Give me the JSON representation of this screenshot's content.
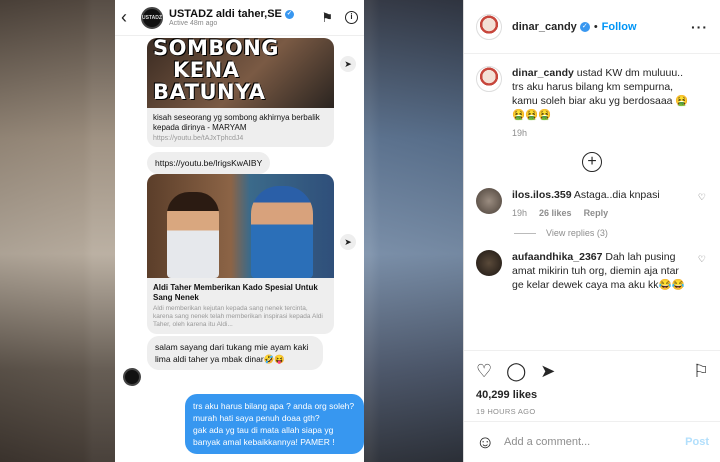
{
  "dm": {
    "back_icon": "‹",
    "avatar_text": "USTADZ",
    "name": "USTADZ aldi taher,SE",
    "status": "Active 48m ago",
    "verified_icon": "✓",
    "flag_icon": "⚑",
    "info_icon": "i",
    "card1": {
      "thumb_line1": "SOMBONG",
      "thumb_line2": "KENA",
      "thumb_line3": "BATUNYA",
      "title": "kisah seseorang yg sombong akhirnya berbalik kepada dirinya - MARYAM",
      "url": "https://youtu.be/tAJxTphcdJ4"
    },
    "link_message": "https://youtu.be/lrigsKwAIBY",
    "card2": {
      "title": "Aldi Taher Memberikan Kado Spesial Untuk Sang Nenek",
      "desc": "Aldi memberikan kejutan kepada sang nenek tercinta, karena sang nenek telah memberikan inspirasi kepada Aldi Taher, oleh karena itu Aldi..."
    },
    "play_icon": "➤",
    "grey_message": "salam sayang dari tukang mie ayam kaki lima aldi taher ya mbak dinar🤣😝",
    "blue_message_1": "trs aku harus bilang apa ? anda org soleh? murah hati saya penuh doaa gth?",
    "blue_message_2": "gak ada yg tau di mata allah siapa yg banyak amal kebaikkannya! PAMER !"
  },
  "post": {
    "username": "dinar_candy",
    "verified_icon": "✓",
    "follow_label": "Follow",
    "bullet": "•",
    "more_icon": "···",
    "caption_user": "dinar_candy",
    "caption_text": " ustad KW dm muluuu.. trs aku harus bilang km sempurna, kamu soleh biar aku yg berdosaaa 🤮🤮🤮🤮",
    "caption_time": "19h",
    "add_icon": "+",
    "comments": [
      {
        "user": "ilos.ilos.359",
        "text": " Astaga..dia knpasi",
        "time": "19h",
        "likes": "26 likes",
        "reply": "Reply",
        "view_replies": "View replies (3)"
      },
      {
        "user": "aufaandhika_2367",
        "text": " Dah lah pusing amat mikirin tuh org, diemin aja ntar ge kelar dewek caya ma aku kk😂😂"
      }
    ],
    "heart_small_icon": "♡",
    "like_icon": "♡",
    "comment_icon": "◯",
    "share_icon": "➤",
    "bookmark_icon": "⚐",
    "likes": "40,299 likes",
    "timestamp": "19 HOURS AGO",
    "emoji_icon": "☺",
    "add_comment_placeholder": "Add a comment...",
    "post_label": "Post"
  }
}
